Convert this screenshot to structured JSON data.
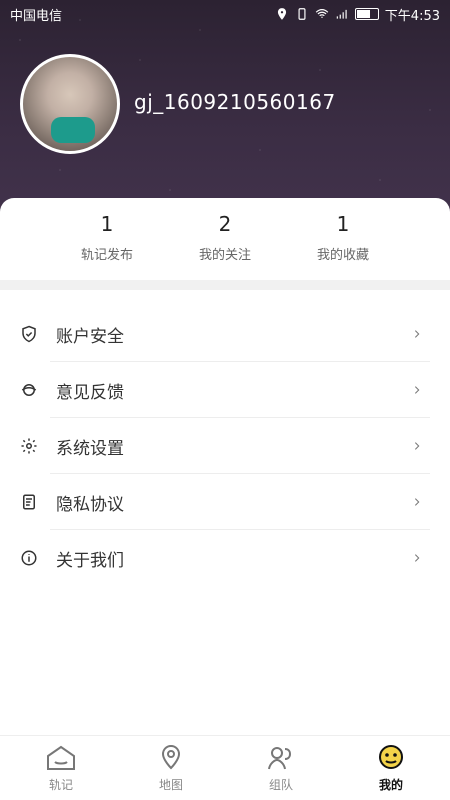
{
  "status": {
    "carrier": "中国电信",
    "time": "下午4:53"
  },
  "profile": {
    "username": "gj_1609210560167"
  },
  "stats": [
    {
      "count": "1",
      "label": "轨记发布"
    },
    {
      "count": "2",
      "label": "我的关注"
    },
    {
      "count": "1",
      "label": "我的收藏"
    }
  ],
  "menu": [
    {
      "label": "账户安全",
      "icon": "shield-icon"
    },
    {
      "label": "意见反馈",
      "icon": "feedback-icon"
    },
    {
      "label": "系统设置",
      "icon": "gear-icon"
    },
    {
      "label": "隐私协议",
      "icon": "document-icon"
    },
    {
      "label": "关于我们",
      "icon": "info-icon"
    }
  ],
  "tabs": [
    {
      "label": "轨记",
      "icon": "home-icon"
    },
    {
      "label": "地图",
      "icon": "map-pin-icon"
    },
    {
      "label": "组队",
      "icon": "group-icon"
    },
    {
      "label": "我的",
      "icon": "smile-icon",
      "active": true
    }
  ],
  "colors": {
    "header_bg": "#3b2d44",
    "active_tab_icon": "#f3d34a"
  }
}
